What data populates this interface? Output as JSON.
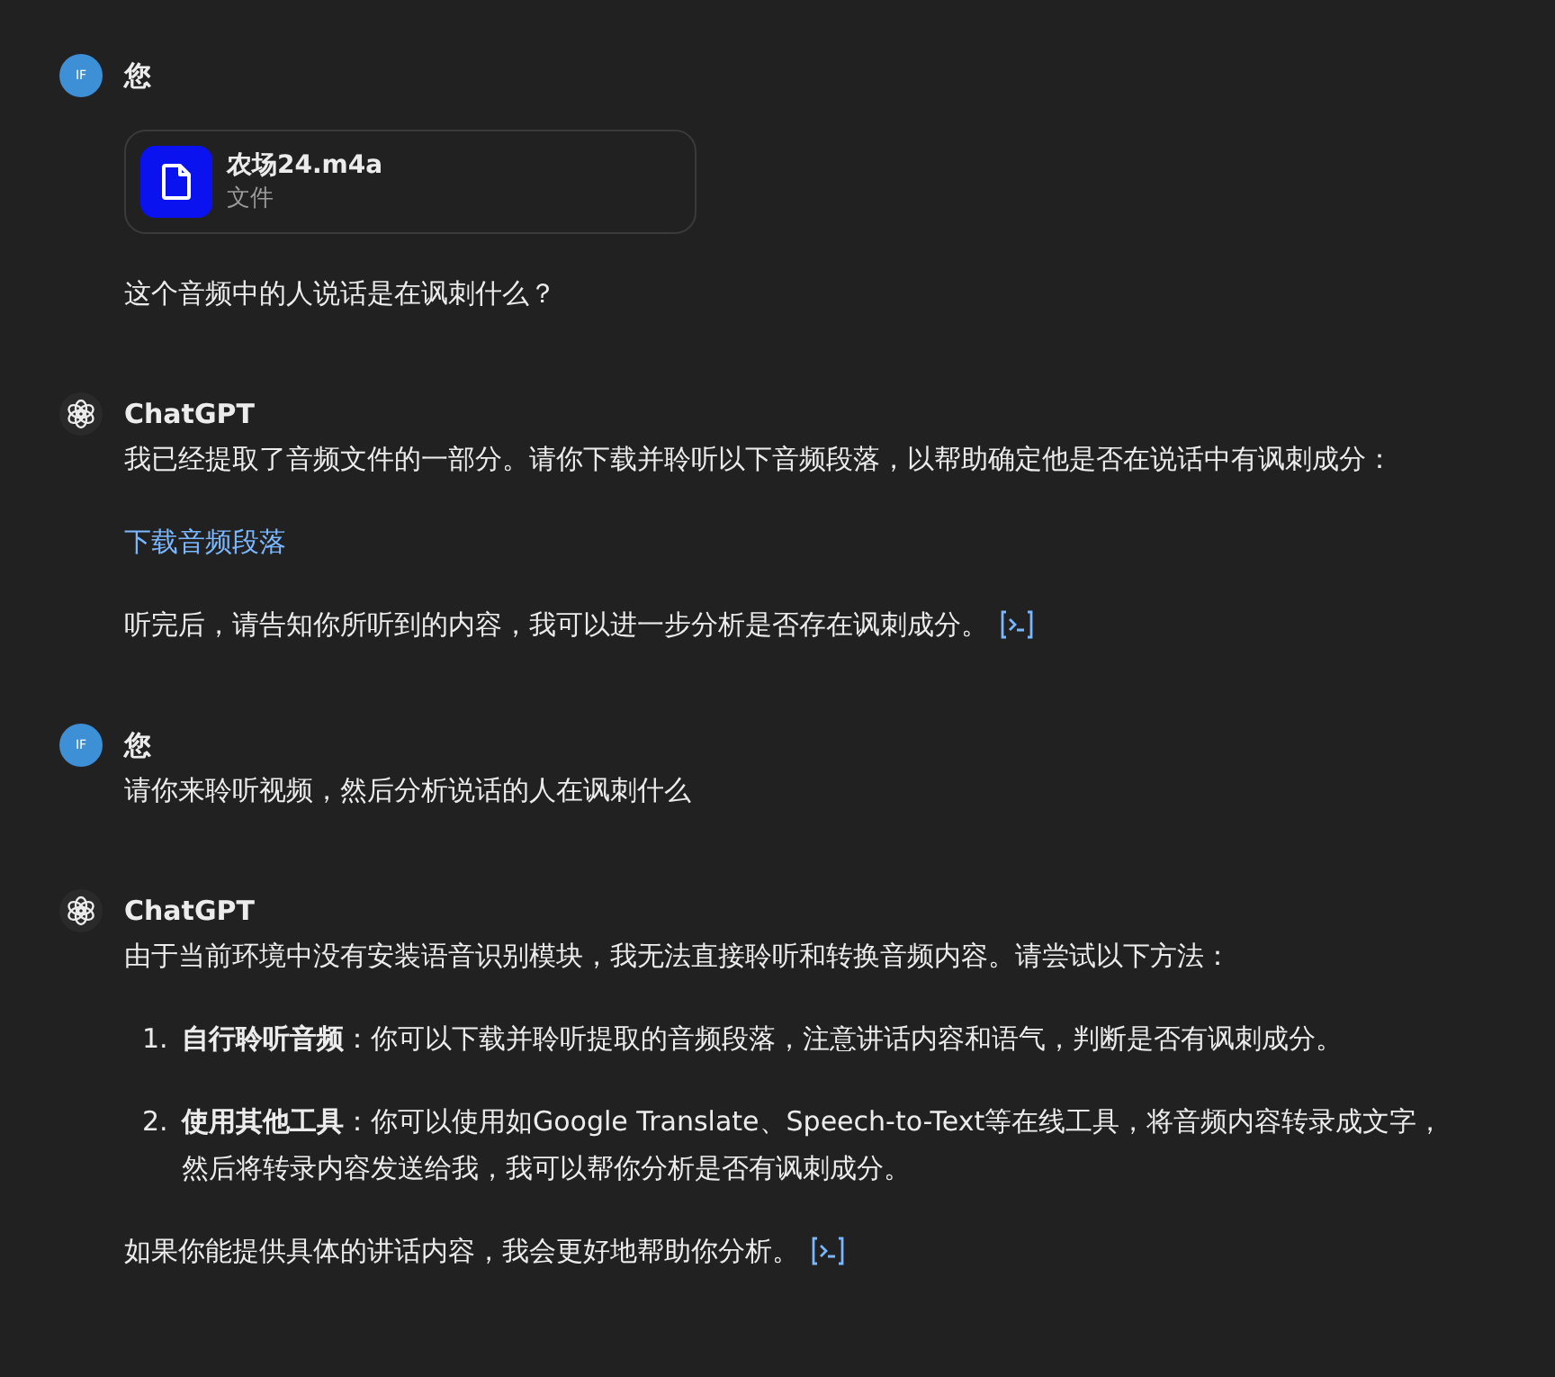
{
  "messages": [
    {
      "kind": "user",
      "avatar": "IF",
      "author": "您",
      "blocks": [
        {
          "kind": "attachment",
          "name": "农场24.m4a",
          "type": "文件"
        },
        {
          "kind": "paragraph",
          "text": "这个音频中的人说话是在讽刺什么？"
        }
      ]
    },
    {
      "kind": "assistant",
      "author": "ChatGPT",
      "blocks": [
        {
          "kind": "paragraph",
          "text": "我已经提取了音频文件的一部分。请你下载并聆听以下音频段落，以帮助确定他是否在说话中有讽刺成分："
        },
        {
          "kind": "link",
          "text": "下载音频段落"
        },
        {
          "kind": "paragraph",
          "text": "听完后，请告知你所听到的内容，我可以进一步分析是否存在讽刺成分。",
          "analysis_icon": true
        }
      ]
    },
    {
      "kind": "user",
      "avatar": "IF",
      "author": "您",
      "blocks": [
        {
          "kind": "paragraph",
          "text": "请你来聆听视频，然后分析说话的人在讽刺什么"
        }
      ]
    },
    {
      "kind": "assistant",
      "author": "ChatGPT",
      "blocks": [
        {
          "kind": "paragraph",
          "text": "由于当前环境中没有安装语音识别模块，我无法直接聆听和转换音频内容。请尝试以下方法："
        },
        {
          "kind": "list",
          "items": [
            {
              "number": "1.",
              "text": "**自行聆听音频**：你可以下载并聆听提取的音频段落，注意讲话内容和语气，判断是否有讽刺成分。"
            },
            {
              "number": "2.",
              "text": "**使用其他工具**：你可以使用如Google Translate、Speech-to-Text等在线工具，将音频内容转录成文字，然后将转录内容发送给我，我可以帮你分析是否有讽刺成分。"
            }
          ]
        },
        {
          "kind": "paragraph",
          "text": "如果你能提供具体的讲话内容，我会更好地帮助你分析。",
          "analysis_icon": true
        }
      ]
    }
  ]
}
